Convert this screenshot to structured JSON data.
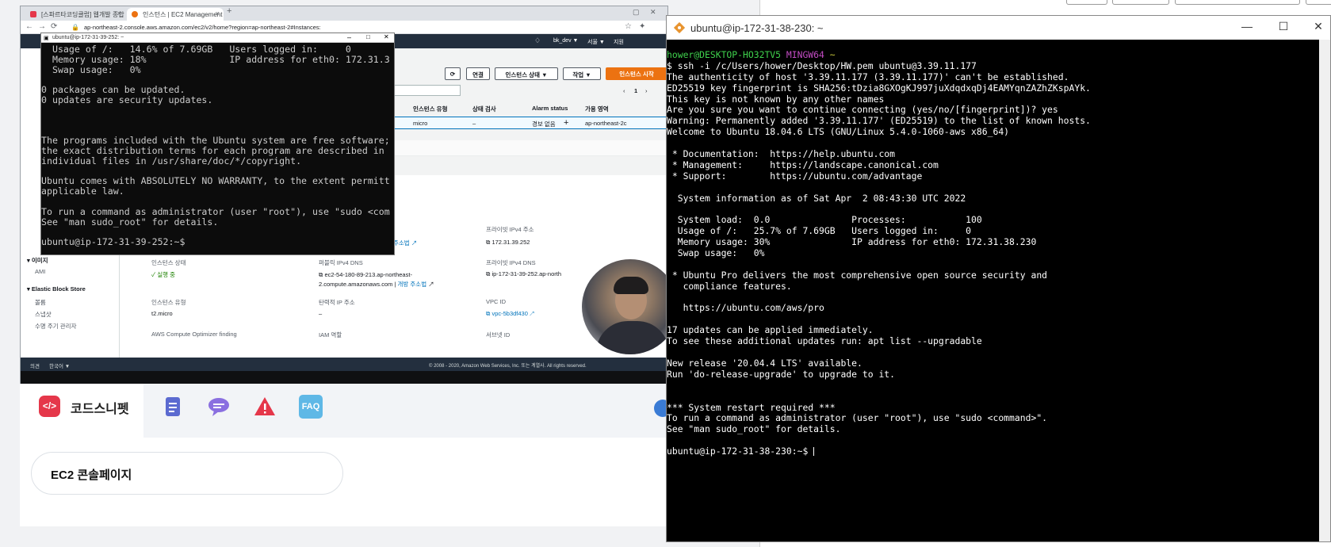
{
  "browser": {
    "tabs": [
      {
        "label": "[스파르타코딩클럽] 웹개발 종합",
        "fav_color": "#e5374a"
      },
      {
        "label": "인스턴스 | EC2 Management Co",
        "fav_color": "#ec7211"
      }
    ],
    "url": "ap-northeast-2.console.aws.amazon.com/ec2/v2/home?region=ap-northeast-2#Instances:"
  },
  "aws": {
    "nav": {
      "account": "bk_dev ▼",
      "region": "서울 ▼",
      "support": "지원"
    },
    "toolbar": {
      "connect": "연결",
      "instance_state": "인스턴스 상태 ▼",
      "actions": "작업 ▼",
      "launch": "인스턴스 시작",
      "page": "1"
    },
    "table": {
      "headers": [
        "인스턴스 유형",
        "상태 검사",
        "Alarm status",
        "가용 영역"
      ],
      "row": [
        "micro",
        "–",
        "경보 없음",
        "ap-northeast-2c"
      ]
    },
    "sidebar": {
      "section_images": "이미지",
      "ami": "AMI",
      "section_ebs": "Elastic Block Store",
      "volumes": "볼륨",
      "snapshots": "스냅샷",
      "lifecycle": "수명 주기 관리자"
    },
    "details": {
      "private_ipv4_label": "프라이빗 IPv4 주소",
      "private_ipv4": "172.31.39.252",
      "instance_state_label": "인스턴스 상태",
      "instance_state": "실행 중",
      "public_dns_label": "퍼블릭 IPv4 DNS",
      "public_dns": "ec2-54-180-89-213.ap-northeast-2.compute.amazonaws.com",
      "open_address": "개방 주소법",
      "private_dns_label": "프라이빗 IPv4 DNS",
      "private_dns": "ip-172-31-39-252.ap-north",
      "instance_type_label": "인스턴스 유형",
      "instance_type": "t2.micro",
      "elastic_ip_label": "탄력적 IP 주소",
      "elastic_ip": "–",
      "vpc_label": "VPC ID",
      "vpc": "vpc-5b3df430",
      "optimizer_label": "AWS Compute Optimizer finding",
      "iam_label": "IAM 역할",
      "subnet_label": "서브넷 ID"
    },
    "footer": {
      "feedback": "의견",
      "lang": "한국어 ▼",
      "copyright": "© 2008 - 2020, Amazon Web Services, Inc. 또는 계열사. All rights reserved."
    }
  },
  "term_small": {
    "title": "ubuntu@ip-172-31-39-252: ~",
    "lines": [
      "  Usage of /:   14.6% of 7.69GB   Users logged in:     0",
      "  Memory usage: 18%               IP address for eth0: 172.31.3",
      "  Swap usage:   0%",
      "",
      "0 packages can be updated.",
      "0 updates are security updates.",
      "",
      "",
      "",
      "The programs included with the Ubuntu system are free software;",
      "the exact distribution terms for each program are described in",
      "individual files in /usr/share/doc/*/copyright.",
      "",
      "Ubuntu comes with ABSOLUTELY NO WARRANTY, to the extent permitt",
      "applicable law.",
      "",
      "To run a command as administrator (user \"root\"), use \"sudo <com",
      "See \"man sudo_root\" for details.",
      "",
      "ubuntu@ip-172-31-39-252:~$"
    ]
  },
  "codesnippet": {
    "logo_text": "코드스니펫",
    "logo_icon": "</>",
    "card_title": "EC2 콘솔페이지",
    "icons": [
      "document-icon",
      "chat-icon",
      "warning-icon",
      "faq-icon"
    ],
    "faq_label": "FAQ"
  },
  "term_big": {
    "title": "ubuntu@ip-172-31-38-230: ~",
    "prompt_user": "hower@DESKTOP-HO32TV5",
    "prompt_env": "MINGW64",
    "prompt_dir": "~",
    "lines": [
      "$ ssh -i /c/Users/hower/Desktop/HW.pem ubuntu@3.39.11.177",
      "The authenticity of host '3.39.11.177 (3.39.11.177)' can't be established.",
      "ED25519 key fingerprint is SHA256:tDzia8GXOgKJ997juXdqdxqDj4EAMYqnZAZhZKspAYk.",
      "This key is not known by any other names",
      "Are you sure you want to continue connecting (yes/no/[fingerprint])? yes",
      "Warning: Permanently added '3.39.11.177' (ED25519) to the list of known hosts.",
      "Welcome to Ubuntu 18.04.6 LTS (GNU/Linux 5.4.0-1060-aws x86_64)",
      "",
      " * Documentation:  https://help.ubuntu.com",
      " * Management:     https://landscape.canonical.com",
      " * Support:        https://ubuntu.com/advantage",
      "",
      "  System information as of Sat Apr  2 08:43:30 UTC 2022",
      "",
      "  System load:  0.0               Processes:           100",
      "  Usage of /:   25.7% of 7.69GB   Users logged in:     0",
      "  Memory usage: 30%               IP address for eth0: 172.31.38.230",
      "  Swap usage:   0%",
      "",
      " * Ubuntu Pro delivers the most comprehensive open source security and",
      "   compliance features.",
      "",
      "   https://ubuntu.com/aws/pro",
      "",
      "17 updates can be applied immediately.",
      "To see these additional updates run: apt list --upgradable",
      "",
      "New release '20.04.4 LTS' available.",
      "Run 'do-release-upgrade' to upgrade to it.",
      "",
      "",
      "*** System restart required ***",
      "To run a command as administrator (user \"root\"), use \"sudo <command>\".",
      "See \"man sudo_root\" for details.",
      "",
      "ubuntu@ip-172-31-38-230:~$ "
    ]
  }
}
